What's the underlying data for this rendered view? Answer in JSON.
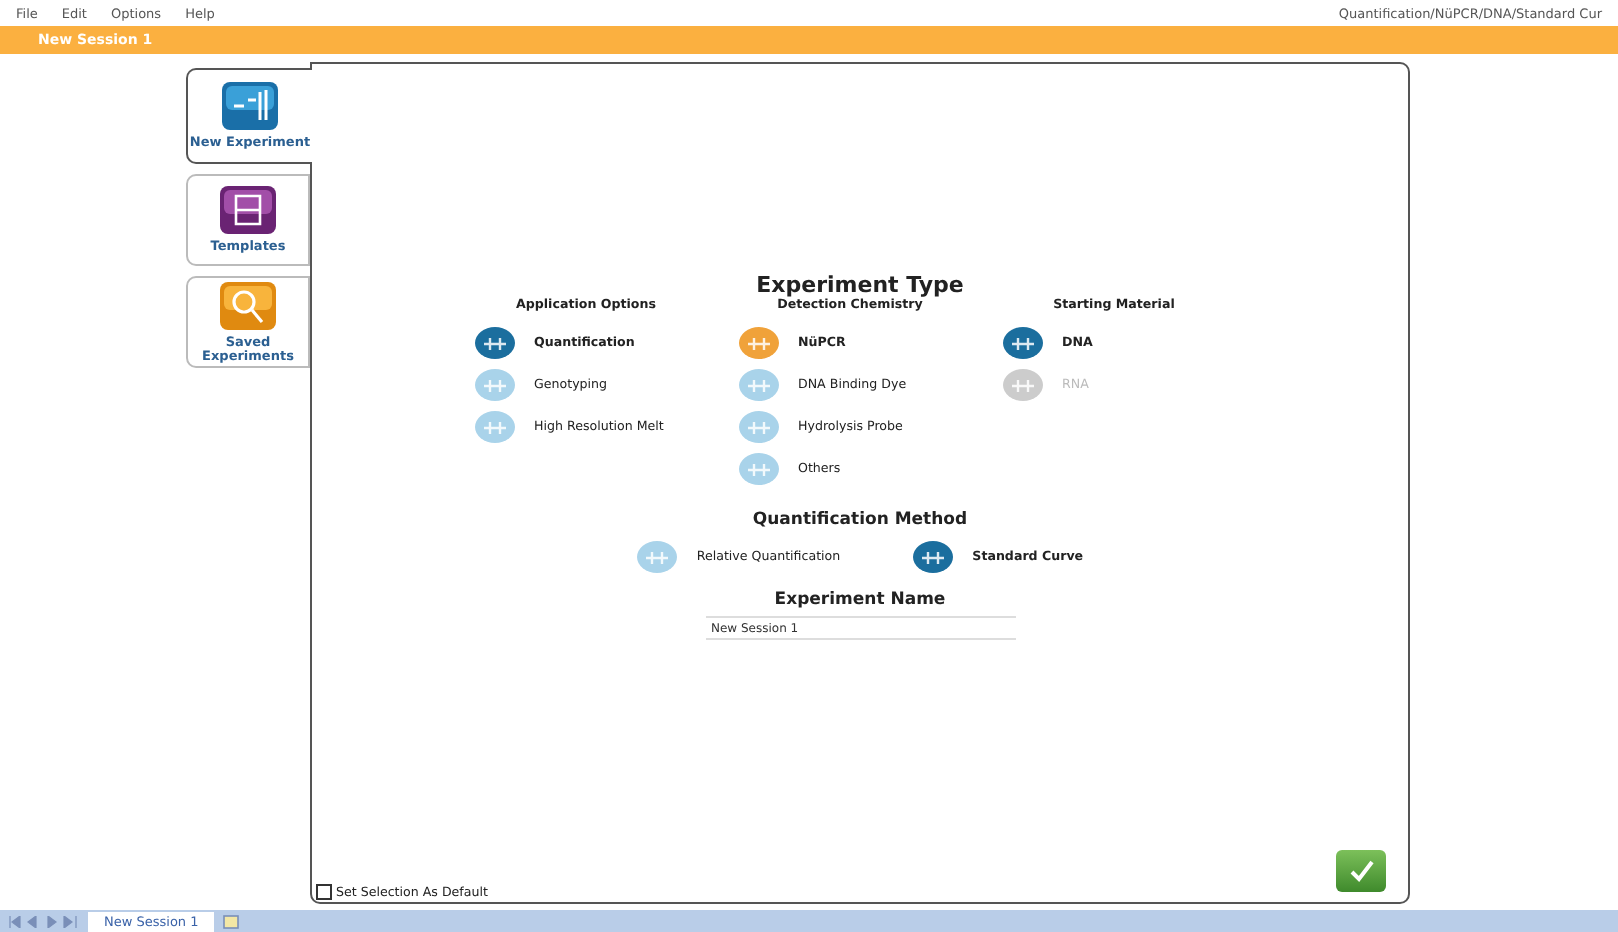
{
  "menu": [
    "File",
    "Edit",
    "Options",
    "Help"
  ],
  "breadcrumb": "Quantification/NüPCR/DNA/Standard Cur",
  "session_title": "New Session 1",
  "sidebar": [
    {
      "label": "New Experiment",
      "kind": "chart",
      "selected": true
    },
    {
      "label": "Templates",
      "kind": "cabinet",
      "selected": false
    },
    {
      "label": "Saved Experiments",
      "kind": "magnifier",
      "selected": false
    }
  ],
  "heading": "Experiment Type",
  "groups": [
    {
      "title": "Application Options",
      "options": [
        {
          "label": "Quantification",
          "selected": true,
          "disabled": false,
          "color": "#1b6e9e"
        },
        {
          "label": "Genotyping",
          "selected": false,
          "disabled": false,
          "color": "#a9d3ea"
        },
        {
          "label": "High Resolution Melt",
          "selected": false,
          "disabled": false,
          "color": "#a9d3ea"
        }
      ]
    },
    {
      "title": "Detection Chemistry",
      "options": [
        {
          "label": "NüPCR",
          "selected": true,
          "disabled": false,
          "color": "#f0a23a"
        },
        {
          "label": "DNA Binding Dye",
          "selected": false,
          "disabled": false,
          "color": "#a9d3ea"
        },
        {
          "label": "Hydrolysis Probe",
          "selected": false,
          "disabled": false,
          "color": "#a9d3ea"
        },
        {
          "label": "Others",
          "selected": false,
          "disabled": false,
          "color": "#a9d3ea"
        }
      ]
    },
    {
      "title": "Starting Material",
      "options": [
        {
          "label": "DNA",
          "selected": true,
          "disabled": false,
          "color": "#1b6e9e"
        },
        {
          "label": "RNA",
          "selected": false,
          "disabled": true,
          "color": "#cccccc"
        }
      ]
    }
  ],
  "method": {
    "title": "Quantification Method",
    "options": [
      {
        "label": "Relative Quantification",
        "selected": false,
        "disabled": false,
        "color": "#a9d3ea"
      },
      {
        "label": "Standard Curve",
        "selected": true,
        "disabled": false,
        "color": "#1b6e9e"
      }
    ]
  },
  "name": {
    "title": "Experiment Name",
    "value": "New Session 1"
  },
  "default_checkbox": {
    "label": "Set Selection As Default",
    "checked": false
  },
  "sheet_tabs": [
    {
      "label": "New Session 1",
      "selected": true
    }
  ]
}
